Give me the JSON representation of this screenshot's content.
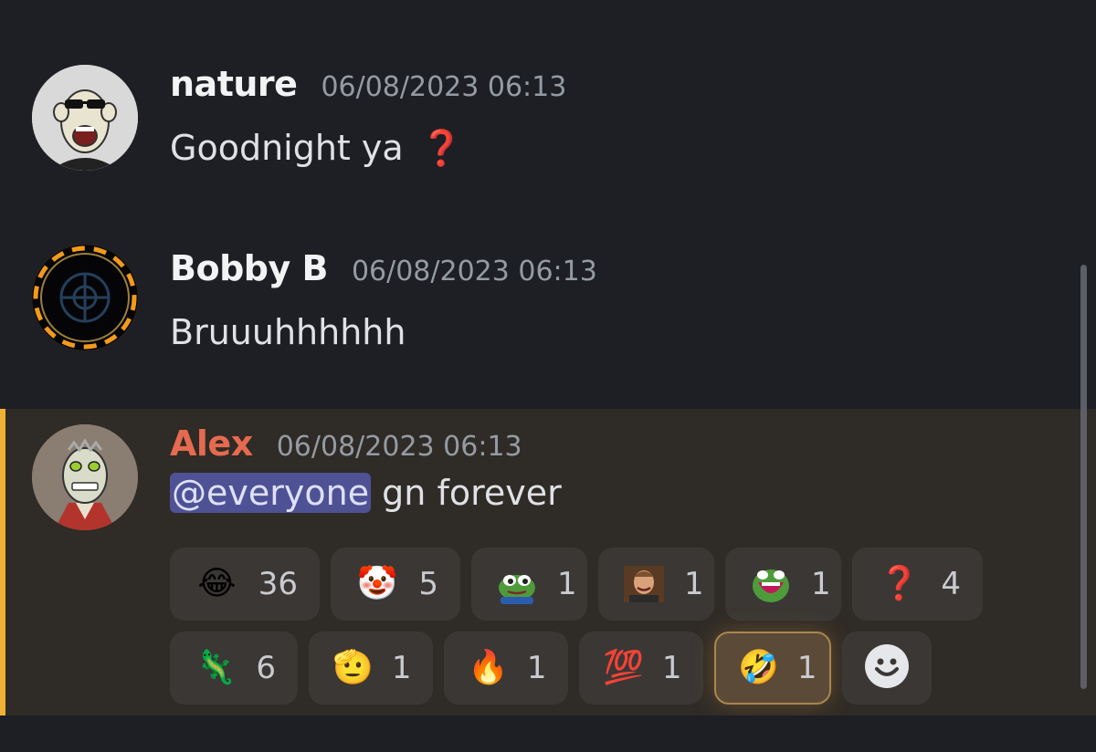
{
  "messages": [
    {
      "username": "nature",
      "timestamp": "06/08/2023 06:13",
      "text": "Goodnight ya",
      "trailing_emoji": "❓",
      "avatar_icon": "ape-sunglasses-avatar"
    },
    {
      "username": "Bobby B",
      "timestamp": "06/08/2023 06:13",
      "text": "Bruuuhhhhhh",
      "avatar_icon": "fire-ring-emblem-avatar"
    },
    {
      "username": "Alex",
      "username_color": "#e56a4f",
      "timestamp": "06/08/2023 06:13",
      "mention": "@everyone",
      "text": " gn forever",
      "avatar_icon": "lizard-avatar",
      "highlight_color": "#f0b232",
      "reactions": [
        {
          "icon": "face-with-tears-of-joy",
          "glyph": "😂",
          "count": "36"
        },
        {
          "icon": "clown-face",
          "glyph": "🤡",
          "count": "5"
        },
        {
          "icon": "pepe-frog",
          "count": "1"
        },
        {
          "icon": "laughing-man-meme",
          "count": "1"
        },
        {
          "icon": "pepe-laughing",
          "count": "1"
        },
        {
          "icon": "red-question-mark",
          "glyph": "❓",
          "count": "4"
        },
        {
          "icon": "lizard",
          "glyph": "🦎",
          "count": "6"
        },
        {
          "icon": "saluting-face",
          "glyph": "🫡",
          "count": "1"
        },
        {
          "icon": "fire",
          "glyph": "🔥",
          "count": "1"
        },
        {
          "icon": "hundred-points",
          "glyph": "💯",
          "count": "1"
        },
        {
          "icon": "rolling-on-floor-laughing",
          "glyph": "🤣",
          "count": "1",
          "selected": true
        }
      ]
    }
  ],
  "colors": {
    "background": "#1e1f24",
    "highlight_background": "#2f2b26",
    "mention_background": "#4e5294"
  }
}
